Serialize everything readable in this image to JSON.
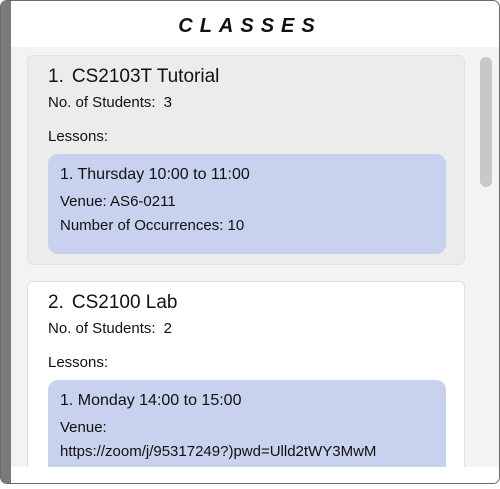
{
  "panel": {
    "title": "CLASSES"
  },
  "classes": [
    {
      "index": "1.",
      "name": "CS2103T Tutorial",
      "students_label": "No. of Students:",
      "students_count": "3",
      "lessons_label": "Lessons:",
      "lesson": {
        "time": "1. Thursday 10:00 to 11:00",
        "venue": "Venue: AS6-0211",
        "occurrences": "Number of Occurrences: 10"
      }
    },
    {
      "index": "2.",
      "name": "CS2100 Lab",
      "students_label": "No. of Students:",
      "students_count": "2",
      "lessons_label": "Lessons:",
      "lesson": {
        "time": "1. Monday 14:00 to 15:00",
        "venue_label": "Venue:",
        "venue_url": "https://zoom/j/95317249?)pwd=Ulld2tWY3MwM"
      }
    }
  ]
}
